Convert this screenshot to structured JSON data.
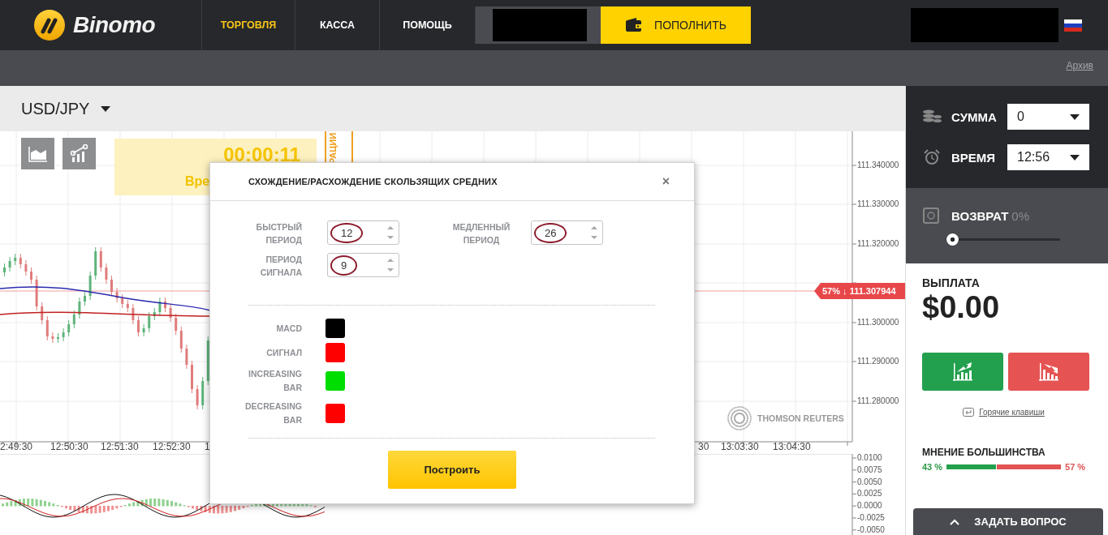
{
  "header": {
    "logo": "Binomo",
    "nav": [
      {
        "label": "ТОРГОВЛЯ",
        "selected": true
      },
      {
        "label": "КАССА",
        "selected": false
      },
      {
        "label": "ПОМОЩЬ",
        "selected": false
      }
    ],
    "deposit_button": "ПОПОЛНИТЬ"
  },
  "toolbar": {
    "archive_link": "Архив"
  },
  "chart": {
    "asset": "USD/JPY",
    "timer": "00:00:11",
    "timer_caption": "Вре",
    "side_tab": "РАЦИИ",
    "price_ticks": [
      "111.340000",
      "111.330000",
      "111.320000",
      "111.300000",
      "111.290000",
      "111.280000"
    ],
    "price_tag": "57% ↓ 111.307944",
    "time_ticks": [
      "2:49:30",
      "12:50:30",
      "12:51:30",
      "12:52:30",
      "1",
      "30",
      "13:03:30",
      "13:04:30"
    ],
    "source_logo": "THOMSON REUTERS",
    "macd_ticks": [
      "0.0100",
      "0.0075",
      "0.0050",
      "0.0025",
      "0.0000",
      "-0.0025",
      "-0.0050"
    ]
  },
  "dialog": {
    "title": "СХОЖДЕНИЕ/РАСХОЖДЕНИЕ СКОЛЬЗЯЩИХ СРЕДНИХ",
    "close": "×",
    "fields": [
      {
        "label": "БЫСТРЫЙ ПЕРИОД",
        "value": "12"
      },
      {
        "label": "МЕДЛЕННЫЙ ПЕРИОД",
        "value": "26"
      },
      {
        "label": "ПЕРИОД СИГНАЛА",
        "value": "9"
      }
    ],
    "colors": [
      {
        "label": "MACD",
        "color": "#000000"
      },
      {
        "label": "СИГНАЛ",
        "color": "#ff0000"
      },
      {
        "label": "INCREASING BAR",
        "color": "#00dd00"
      },
      {
        "label": "DECREASING BAR",
        "color": "#ff0000"
      }
    ],
    "submit_button": "Построить"
  },
  "trade_panel": {
    "amount": {
      "label": "СУММА",
      "value": "0"
    },
    "time": {
      "label": "ВРЕМЯ",
      "value": "12:56"
    },
    "refund": {
      "label": "ВОЗВРАТ",
      "percent": "0%",
      "level": 0
    },
    "payout": {
      "label": "ВЫПЛАТА",
      "value": "$0.00"
    },
    "hotkeys_link": "Горячие клавиши",
    "majority": {
      "title": "МНЕНИЕ БОЛЬШИНСТВА",
      "up_percent": "43 %",
      "down_percent": "57 %",
      "level": 0.43
    },
    "ask_button": "ЗАДАТЬ ВОПРОС"
  }
}
